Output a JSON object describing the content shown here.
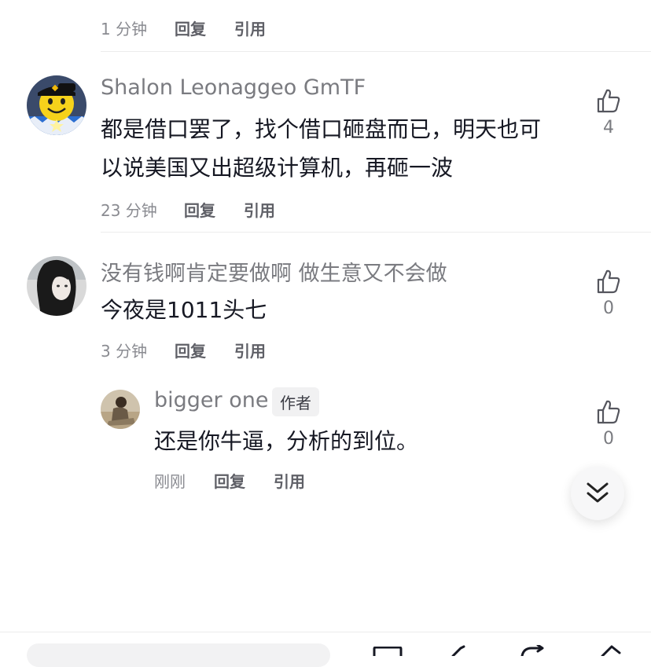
{
  "top_comment": {
    "time": "1 分钟",
    "reply_label": "回复",
    "quote_label": "引用"
  },
  "comments": [
    {
      "username": "Shalon Leonaggeo GmTF",
      "lines": [
        "都是借口罢了，找个借口砸盘而已，明天也可",
        "以说美国又出超级计算机，再砸一波"
      ],
      "time": "23 分钟",
      "reply_label": "回复",
      "quote_label": "引用",
      "likes": "4"
    },
    {
      "username": "没有钱啊肯定要做啊 做生意又不会做",
      "lines": [
        "今夜是1011头七"
      ],
      "time": "3 分钟",
      "reply_label": "回复",
      "quote_label": "引用",
      "likes": "0"
    }
  ],
  "reply": {
    "username": "bigger one",
    "badge": "作者",
    "text": "还是你牛逼，分析的到位。",
    "time": "刚刚",
    "reply_label": "回复",
    "quote_label": "引用",
    "likes": "0"
  },
  "colors": {
    "text_primary": "#161823",
    "text_secondary": "#8a8b91",
    "divider": "#ececec"
  },
  "icons": {
    "like": "thumb-up-icon",
    "scroll_down": "double-chevron-down-icon"
  }
}
